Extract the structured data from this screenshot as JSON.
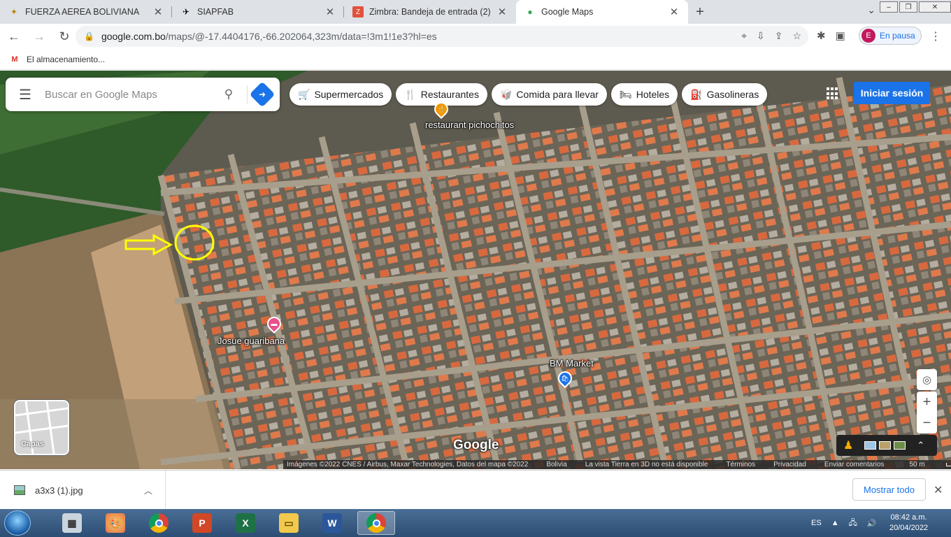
{
  "browser": {
    "tabs": [
      {
        "label": "FUERZA AEREA BOLIVIANA",
        "icon": "fab-emblem-icon",
        "active": false
      },
      {
        "label": "SIAPFAB",
        "icon": "aircraft-icon",
        "active": false
      },
      {
        "label": "Zimbra: Bandeja de entrada (2)",
        "icon": "zimbra-icon",
        "active": false
      },
      {
        "label": "Google Maps",
        "icon": "google-maps-icon",
        "active": true
      }
    ],
    "url_main": "google.com.bo",
    "url_rest": "/maps/@-17.4404176,-66.202064,323m/data=!3m1!1e3?hl=es",
    "profile_initial": "E",
    "profile_status": "En pausa",
    "bookmark": "El almacenamiento..."
  },
  "maps": {
    "search_placeholder": "Buscar en Google Maps",
    "chips": [
      {
        "label": "Supermercados",
        "icon": "cart-icon"
      },
      {
        "label": "Restaurantes",
        "icon": "fork-knife-icon"
      },
      {
        "label": "Comida para llevar",
        "icon": "takeout-icon"
      },
      {
        "label": "Hoteles",
        "icon": "bed-icon"
      },
      {
        "label": "Gasolineras",
        "icon": "fuel-icon"
      }
    ],
    "signin_label": "Iniciar sesión",
    "places": [
      {
        "name": "restaurant pichochitos",
        "color": "#f29900"
      },
      {
        "name": "Josue guaribana",
        "color": "#e8508a"
      },
      {
        "name": "BM Market",
        "color": "#1a73e8"
      }
    ],
    "layers_label": "Capas",
    "logo": "Google",
    "attribution": [
      "Imágenes ©2022 CNES / Airbus, Maxar Technologies, Datos del mapa ©2022",
      "Bolivia",
      "La vista Tierra en 3D no está disponible",
      "Términos",
      "Privacidad",
      "Enviar comentarios"
    ],
    "scale_label": "50 m"
  },
  "downloads": {
    "file_name": "a3x3 (1).jpg",
    "show_all_label": "Mostrar todo"
  },
  "taskbar": {
    "apps": [
      "calculator",
      "paint",
      "chrome",
      "powerpoint",
      "excel",
      "explorer",
      "word",
      "chrome-profile"
    ],
    "language": "ES",
    "time": "08:42 a.m.",
    "date": "20/04/2022"
  }
}
